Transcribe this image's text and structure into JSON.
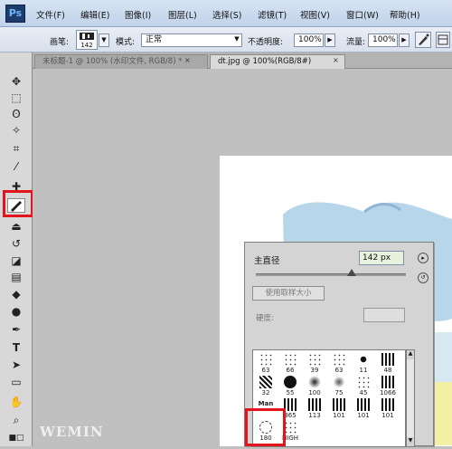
{
  "app": {
    "logo": "Ps"
  },
  "menu": [
    "文件(F)",
    "编辑(E)",
    "图像(I)",
    "图层(L)",
    "选择(S)",
    "滤镜(T)",
    "视图(V)",
    "窗口(W)",
    "帮助(H)"
  ],
  "options": {
    "brush_label": "画笔:",
    "brush_size_preview": "142",
    "mode_label": "模式:",
    "mode_value": "正常",
    "opacity_label": "不透明度:",
    "opacity_value": "100%",
    "flow_label": "流量:",
    "flow_value": "100%"
  },
  "tabs": [
    {
      "label": "未标题-1 @ 100% (水印文件, RGB/8) *",
      "active": false
    },
    {
      "label": "dt.jpg @ 100%(RGB/8#)",
      "active": true
    }
  ],
  "brush_panel": {
    "master_diameter_label": "主直径",
    "master_diameter_value": "142 px",
    "master_diameter_level": 0.64,
    "use_sample_size_button": "使用取样大小",
    "hardness_label": "硬度:",
    "hardness_value": "",
    "presets": [
      {
        "size": "63"
      },
      {
        "size": "66"
      },
      {
        "size": "39"
      },
      {
        "size": "63"
      },
      {
        "size": "11"
      },
      {
        "size": "48"
      },
      {
        "size": "32"
      },
      {
        "size": "55"
      },
      {
        "size": "100"
      },
      {
        "size": "75"
      },
      {
        "size": "45"
      },
      {
        "size": "1066"
      },
      {
        "size": "",
        "label": "Man"
      },
      {
        "size": "365"
      },
      {
        "size": "113"
      },
      {
        "size": "101"
      },
      {
        "size": "101"
      },
      {
        "size": "101"
      },
      {
        "size": "180"
      },
      {
        "size": "HIGH"
      }
    ]
  },
  "watermark": "WEMIN",
  "colors": {
    "highlight": "#e3141b",
    "map_blue": "#b8d6ea"
  }
}
